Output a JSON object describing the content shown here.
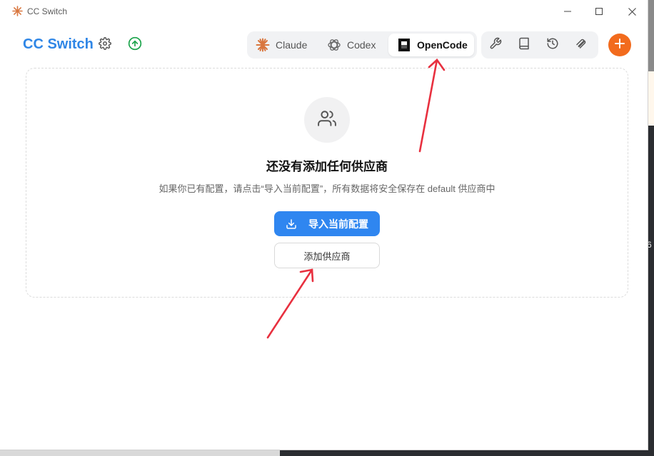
{
  "window": {
    "title": "CC Switch"
  },
  "header": {
    "brand": "CC Switch"
  },
  "tabs": [
    {
      "label": "Claude",
      "icon": "claude-icon"
    },
    {
      "label": "Codex",
      "icon": "codex-icon"
    },
    {
      "label": "OpenCode",
      "icon": "opencode-icon",
      "active": true
    }
  ],
  "tools": [
    "wrench-icon",
    "book-icon",
    "history-icon",
    "attachment-icon"
  ],
  "empty_state": {
    "title": "还没有添加任何供应商",
    "description": "如果你已有配置，请点击“导入当前配置”，所有数据将安全保存在 default 供应商中",
    "import_button": "导入当前配置",
    "add_button": "添加供应商"
  },
  "colors": {
    "brand": "#2f86e6",
    "primary": "#2f86f0",
    "accent": "#f26b1d",
    "update": "#1aa34a",
    "annotation_arrow": "#e8303f"
  },
  "background": {
    "side_label": "6"
  }
}
